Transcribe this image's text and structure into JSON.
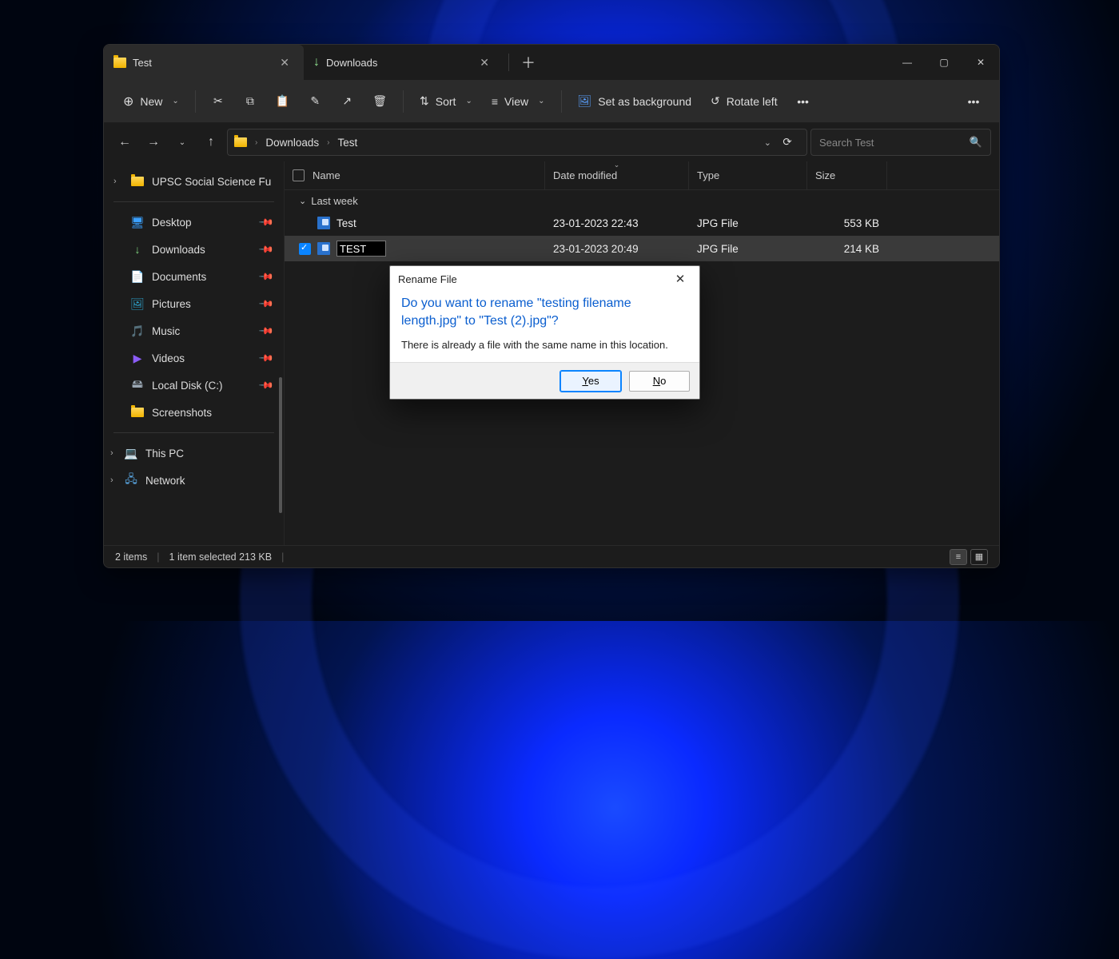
{
  "tabs": [
    {
      "label": "Test",
      "icon": "folder",
      "active": true
    },
    {
      "label": "Downloads",
      "icon": "download",
      "active": false
    }
  ],
  "window_controls": {
    "min": "—",
    "max": "▢",
    "close": "✕"
  },
  "toolbar": {
    "new_label": "New",
    "sort_label": "Sort",
    "view_label": "View",
    "set_bg_label": "Set as background",
    "rotate_left_label": "Rotate left"
  },
  "breadcrumb": [
    "Downloads",
    "Test"
  ],
  "search_placeholder": "Search Test",
  "columns": {
    "name": "Name",
    "date": "Date modified",
    "type": "Type",
    "size": "Size"
  },
  "group_label": "Last week",
  "files": [
    {
      "name": "Test",
      "date": "23-01-2023 22:43",
      "type": "JPG File",
      "size": "553 KB",
      "selected": false,
      "editing": false
    },
    {
      "name": "TEST",
      "date": "23-01-2023 20:49",
      "type": "JPG File",
      "size": "214 KB",
      "selected": true,
      "editing": true
    }
  ],
  "sidebar_top": {
    "label": "UPSC Social Science Fu"
  },
  "sidebar_pinned": [
    {
      "label": "Desktop",
      "icon": "🖥",
      "color": "#3aa0ff",
      "pinned": true
    },
    {
      "label": "Downloads",
      "icon": "↓",
      "color": "#7fd37f",
      "pinned": true
    },
    {
      "label": "Documents",
      "icon": "📄",
      "color": "#9bb8d3",
      "pinned": true
    },
    {
      "label": "Pictures",
      "icon": "🖼",
      "color": "#2da0c8",
      "pinned": true
    },
    {
      "label": "Music",
      "icon": "🎵",
      "color": "#e66",
      "pinned": true
    },
    {
      "label": "Videos",
      "icon": "▶",
      "color": "#8b5cf6",
      "pinned": true
    },
    {
      "label": "Local Disk (C:)",
      "icon": "🖴",
      "color": "#9aa7b3",
      "pinned": true
    },
    {
      "label": "Screenshots",
      "icon": "folder",
      "pinned": false
    }
  ],
  "sidebar_bottom": [
    {
      "label": "This PC",
      "icon": "💻"
    },
    {
      "label": "Network",
      "icon": "🖧"
    }
  ],
  "status": {
    "items": "2 items",
    "selected": "1 item selected  213 KB"
  },
  "dialog": {
    "title": "Rename File",
    "question": "Do you want to rename \"testing filename length.jpg\" to \"Test (2).jpg\"?",
    "message": "There is already a file with the same name in this location.",
    "yes": "Yes",
    "no": "No"
  }
}
